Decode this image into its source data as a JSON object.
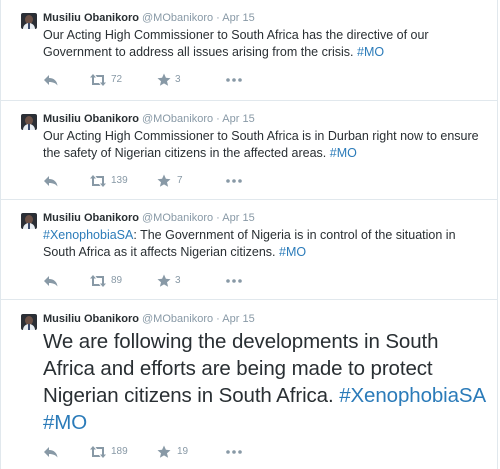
{
  "tweets": [
    {
      "fullname": "Musiliu Obanikoro",
      "username": "@MObanikoro",
      "separator": "·",
      "time": "Apr 15",
      "text_parts": [
        "Our Acting High Commissioner to South Africa has the directive of our Government to address all issues arising from the crisis. ",
        "#MO"
      ],
      "retweets": "72",
      "favorites": "3"
    },
    {
      "fullname": "Musiliu Obanikoro",
      "username": "@MObanikoro",
      "separator": "·",
      "time": "Apr 15",
      "text_parts": [
        "Our Acting High Commissioner to South Africa is in Durban right now to ensure the safety of Nigerian citizens in the affected areas. ",
        "#MO"
      ],
      "retweets": "139",
      "favorites": "7"
    },
    {
      "fullname": "Musiliu Obanikoro",
      "username": "@MObanikoro",
      "separator": "·",
      "time": "Apr 15",
      "text_parts": [
        "#XenophobiaSA",
        ": The Government of Nigeria is in control of the situation in South Africa as it affects Nigerian citizens. ",
        "#MO"
      ],
      "retweets": "89",
      "favorites": "3"
    },
    {
      "fullname": "Musiliu Obanikoro",
      "username": "@MObanikoro",
      "separator": "·",
      "time": "Apr 15",
      "text_parts": [
        "We are following the developments in South Africa and efforts are being made to protect Nigerian citizens in South Africa. ",
        "#XenophobiaSA",
        " ",
        "#MO"
      ],
      "retweets": "189",
      "favorites": "19"
    }
  ],
  "icons": {
    "reply": "reply-icon",
    "retweet": "retweet-icon",
    "favorite": "star-icon",
    "more": "more-icon"
  },
  "colors": {
    "link": "#2b7bb9",
    "muted": "#8899a6",
    "text": "#292f33",
    "border": "#e1e8ed"
  }
}
